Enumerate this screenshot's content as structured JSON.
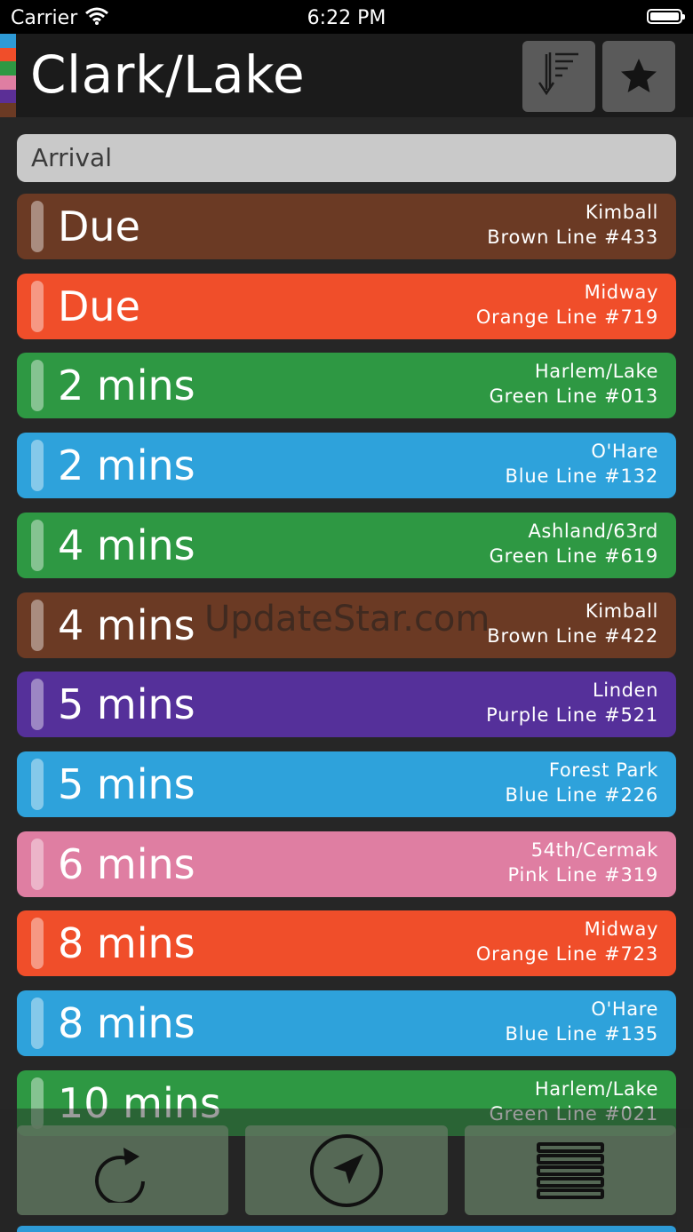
{
  "status_bar": {
    "carrier": "Carrier",
    "time": "6:22 PM"
  },
  "header": {
    "title": "Clark/Lake",
    "line_stripe_colors": [
      "#2e9ad6",
      "#f04e2a",
      "#2e9843",
      "#df7ea2",
      "#5b2f96",
      "#6b3a24"
    ],
    "sort_icon": "sort-descending-icon",
    "favorite_icon": "star-icon"
  },
  "section": {
    "label": "Arrival"
  },
  "arrivals": [
    {
      "eta": "Due",
      "destination": "Kimball",
      "run": "Brown Line #433",
      "color": "#6b3a24"
    },
    {
      "eta": "Due",
      "destination": "Midway",
      "run": "Orange Line #719",
      "color": "#f04e2a"
    },
    {
      "eta": "2 mins",
      "destination": "Harlem/Lake",
      "run": "Green Line #013",
      "color": "#2e9843"
    },
    {
      "eta": "2 mins",
      "destination": "O'Hare",
      "run": "Blue Line #132",
      "color": "#2ea2db"
    },
    {
      "eta": "4 mins",
      "destination": "Ashland/63rd",
      "run": "Green Line #619",
      "color": "#2e9843"
    },
    {
      "eta": "4 mins",
      "destination": "Kimball",
      "run": "Brown Line #422",
      "color": "#6b3a24"
    },
    {
      "eta": "5 mins",
      "destination": "Linden",
      "run": "Purple Line #521",
      "color": "#55309a"
    },
    {
      "eta": "5 mins",
      "destination": "Forest Park",
      "run": "Blue Line #226",
      "color": "#2ea2db"
    },
    {
      "eta": "6 mins",
      "destination": "54th/Cermak",
      "run": "Pink Line #319",
      "color": "#df7ea2"
    },
    {
      "eta": "8 mins",
      "destination": "Midway",
      "run": "Orange Line #723",
      "color": "#f04e2a"
    },
    {
      "eta": "8 mins",
      "destination": "O'Hare",
      "run": "Blue Line #135",
      "color": "#2ea2db"
    },
    {
      "eta": "10 mins",
      "destination": "Harlem/Lake",
      "run": "Green Line #021",
      "color": "#2e9843"
    }
  ],
  "watermark": "UpdateStar.com",
  "toolbar": {
    "refresh_icon": "refresh-icon",
    "locate_icon": "location-arrow-icon",
    "list_icon": "list-icon"
  }
}
